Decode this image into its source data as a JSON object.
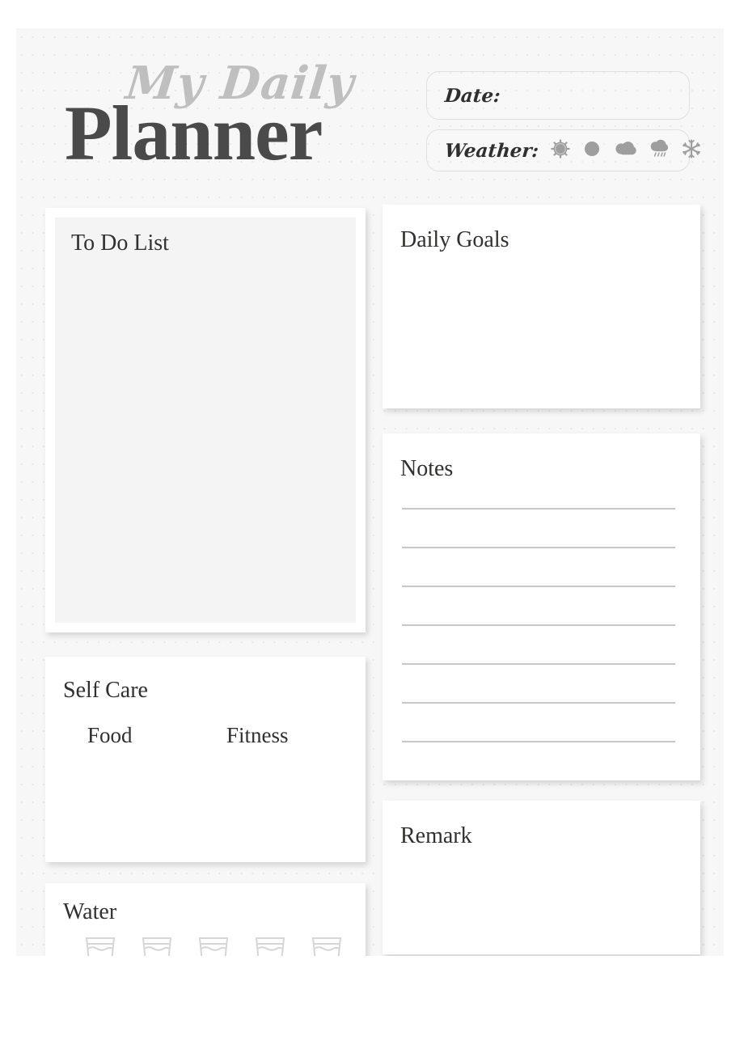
{
  "page": {
    "title_script": "My Daily",
    "title_main": "Planner",
    "background_color": "#f7f7f7",
    "card_color": "#ffffff",
    "text_color": "#30302f",
    "accent_gray": "#bfbfbf"
  },
  "header": {
    "date": {
      "label": "Date:",
      "value": "",
      "placeholder": ""
    },
    "weather": {
      "label": "Weather:",
      "options": [
        {
          "name": "sunny-icon",
          "label": "Sunny"
        },
        {
          "name": "clear-circle-icon",
          "label": "Clear"
        },
        {
          "name": "cloudy-icon",
          "label": "Cloudy"
        },
        {
          "name": "rainy-icon",
          "label": "Rainy"
        },
        {
          "name": "snowy-icon",
          "label": "Snowy"
        }
      ]
    }
  },
  "left_column": {
    "todo": {
      "title": "To Do List",
      "value": ""
    },
    "self_care": {
      "title": "Self Care",
      "columns": [
        {
          "label": "Food",
          "value": ""
        },
        {
          "label": "Fitness",
          "value": ""
        }
      ]
    },
    "water": {
      "title": "Water",
      "glass_count": 5,
      "glasses": [
        {
          "filled": false
        },
        {
          "filled": false
        },
        {
          "filled": false
        },
        {
          "filled": false
        },
        {
          "filled": false
        }
      ]
    }
  },
  "right_column": {
    "daily_goals": {
      "title": "Daily Goals",
      "value": ""
    },
    "notes": {
      "title": "Notes",
      "line_count": 7,
      "lines": [
        "",
        "",
        "",
        "",
        "",
        "",
        ""
      ]
    },
    "remark": {
      "title": "Remark",
      "value": ""
    }
  }
}
